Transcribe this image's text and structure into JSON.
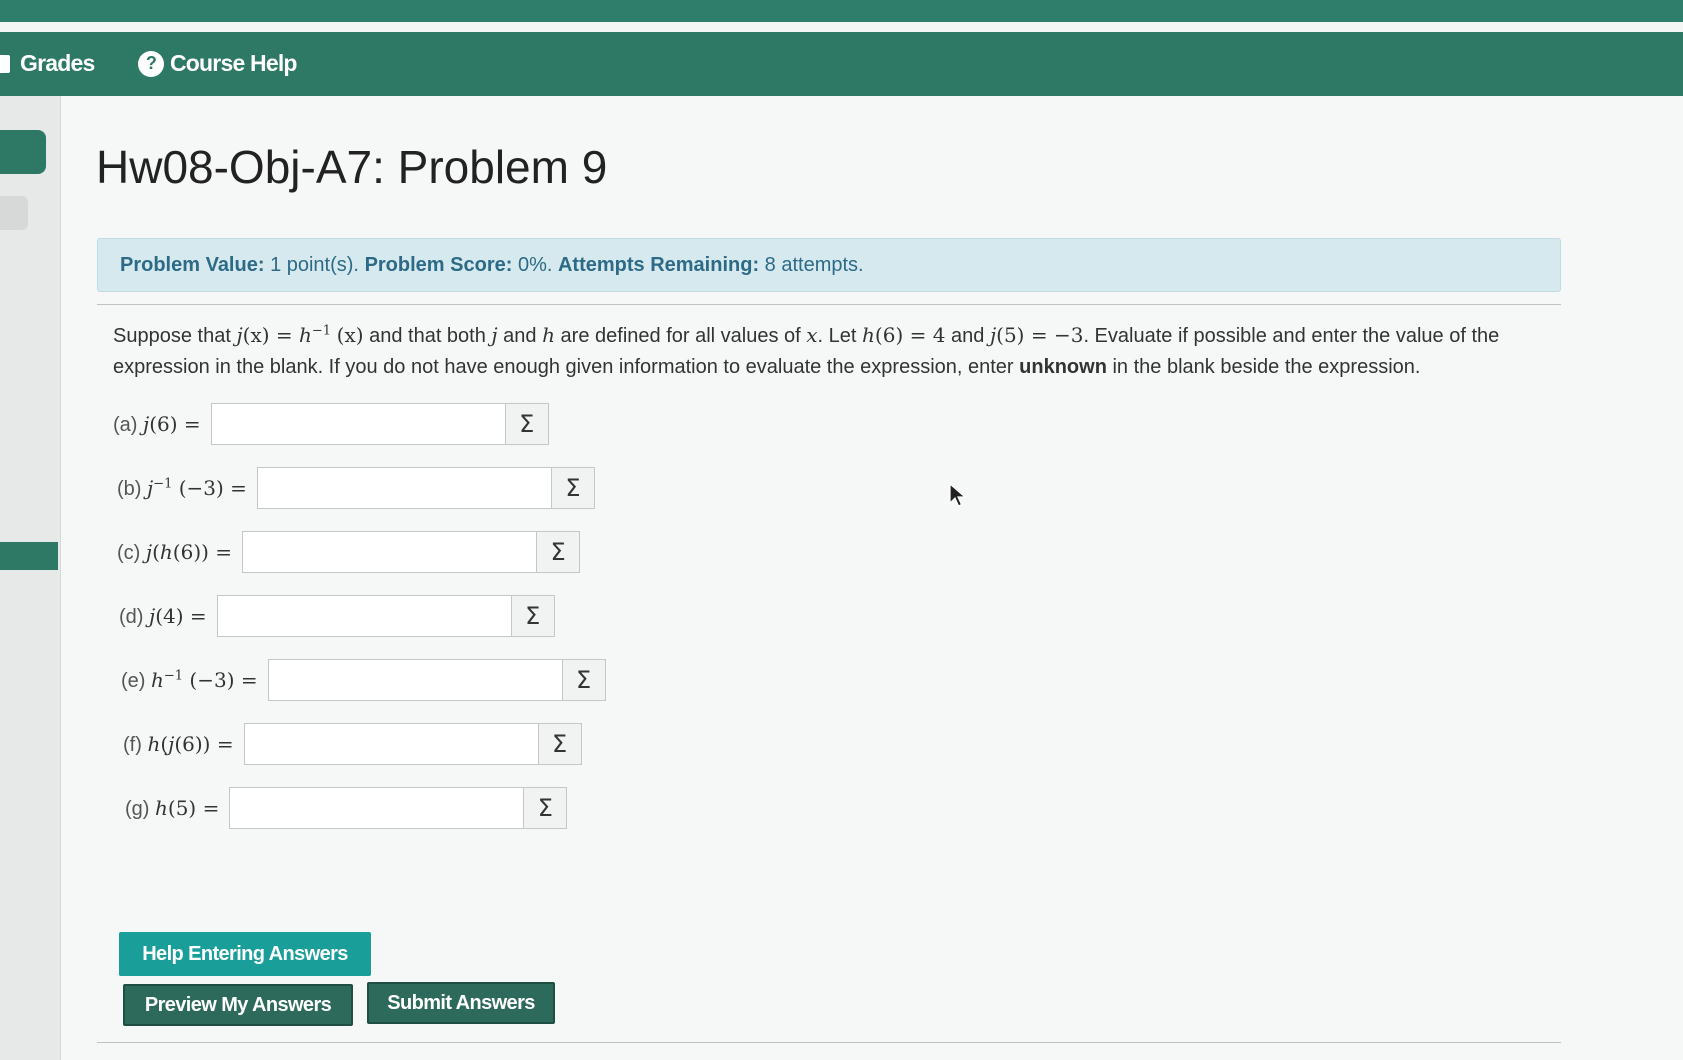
{
  "nav": {
    "grades_label": "Grades",
    "course_help_label": "Course Help",
    "help_icon_glyph": "?"
  },
  "page": {
    "title": "Hw08-Obj-A7: Problem 9"
  },
  "info": {
    "value_label": "Problem Value:",
    "value_text": "1 point(s).",
    "score_label": "Problem Score:",
    "score_text": "0%.",
    "attempts_label": "Attempts Remaining:",
    "attempts_text": "8 attempts."
  },
  "problem": {
    "t1": "Suppose that ",
    "t2": " and that both ",
    "t3": " and ",
    "t4": " are defined for all values of ",
    "t5": ". Let ",
    "t6": " and ",
    "t7": ". Evaluate if possible and enter the value of the expression in the blank. If you do not have enough given information to evaluate the expression, enter ",
    "unknown_word": "unknown",
    "t8": " in the blank beside the expression."
  },
  "math": {
    "j": "j",
    "h": "h",
    "x": "x",
    "inv": "−1",
    "paren_x": "(x)",
    "eq": " = ",
    "h6_eq_4": "(6) = 4",
    "j5_eq": "(5) = −3"
  },
  "parts": [
    {
      "letter": "(a) ",
      "f": "j",
      "arg": "(6) ="
    },
    {
      "letter": "(b) ",
      "f": "j",
      "sup": "−1",
      "arg": " (−3) ="
    },
    {
      "letter": "(c) ",
      "f": "j",
      "mid": "(",
      "g": "h",
      "arg": "(6)) ="
    },
    {
      "letter": "(d) ",
      "f": "j",
      "arg": "(4) ="
    },
    {
      "letter": "(e) ",
      "f": "h",
      "sup": "−1",
      "arg": " (−3) ="
    },
    {
      "letter": "(f) ",
      "f": "h",
      "mid": "(",
      "g": "j",
      "arg": "(6)) ="
    },
    {
      "letter": "(g) ",
      "f": "h",
      "arg": "(5) ="
    }
  ],
  "sigma_glyph": "Σ",
  "buttons": {
    "help": "Help Entering Answers",
    "preview": "Preview My Answers",
    "submit": "Submit Answers"
  },
  "colors": {
    "nav_green": "#2e7866",
    "info_bg": "#d6e9ef",
    "info_text": "#2c6a86",
    "help_button": "#1a9e9a",
    "dark_button": "#2e6a5c"
  }
}
